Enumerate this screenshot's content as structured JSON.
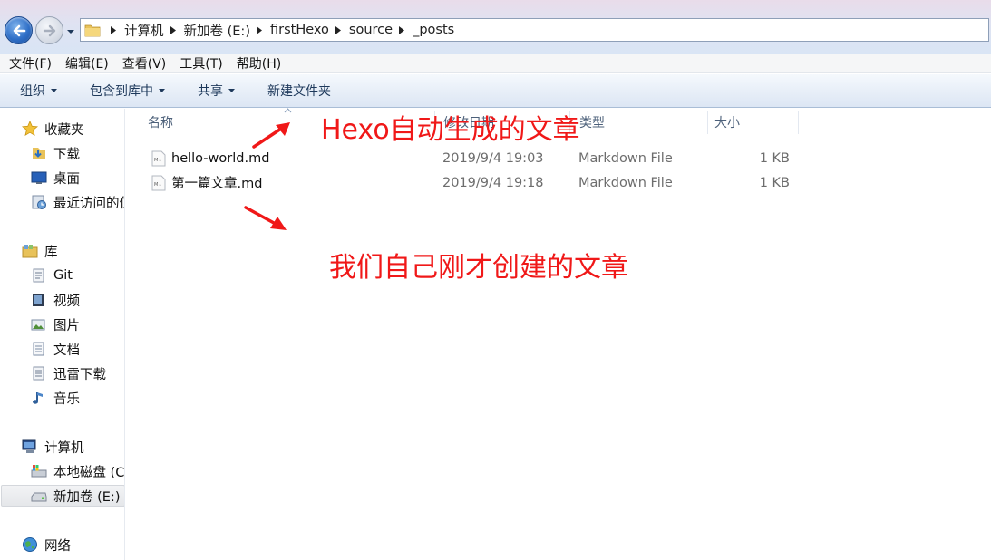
{
  "address_bar": {
    "breadcrumbs": [
      "计算机",
      "新加卷 (E:)",
      "firstHexo",
      "source",
      "_posts"
    ]
  },
  "menu": [
    "文件(F)",
    "编辑(E)",
    "查看(V)",
    "工具(T)",
    "帮助(H)"
  ],
  "toolbar": {
    "organize": "组织",
    "include_in_library": "包含到库中",
    "share": "共享",
    "new_folder": "新建文件夹"
  },
  "nav": {
    "favorites": "收藏夹",
    "downloads": "下载",
    "desktop": "桌面",
    "recent": "最近访问的位",
    "libraries": "库",
    "git": "Git",
    "videos": "视频",
    "pictures": "图片",
    "documents": "文档",
    "thunder": "迅雷下载",
    "music": "音乐",
    "computer": "计算机",
    "local_disk": "本地磁盘 (C",
    "new_volume": "新加卷 (E:)",
    "network": "网络"
  },
  "columns": {
    "name": "名称",
    "date": "修改日期",
    "type": "类型",
    "size": "大小"
  },
  "files": [
    {
      "name": "hello-world.md",
      "date": "2019/9/4 19:03",
      "type": "Markdown File",
      "size": "1 KB"
    },
    {
      "name": "第一篇文章.md",
      "date": "2019/9/4 19:18",
      "type": "Markdown File",
      "size": "1 KB"
    }
  ],
  "annotations": {
    "auto_generated": "Hexo自动生成的文章",
    "created_by_us": "我们自己刚才创建的文章"
  },
  "colors": {
    "annotation": "#f01818",
    "toolbar_text": "#1e395b",
    "header_text": "#4c607a"
  }
}
